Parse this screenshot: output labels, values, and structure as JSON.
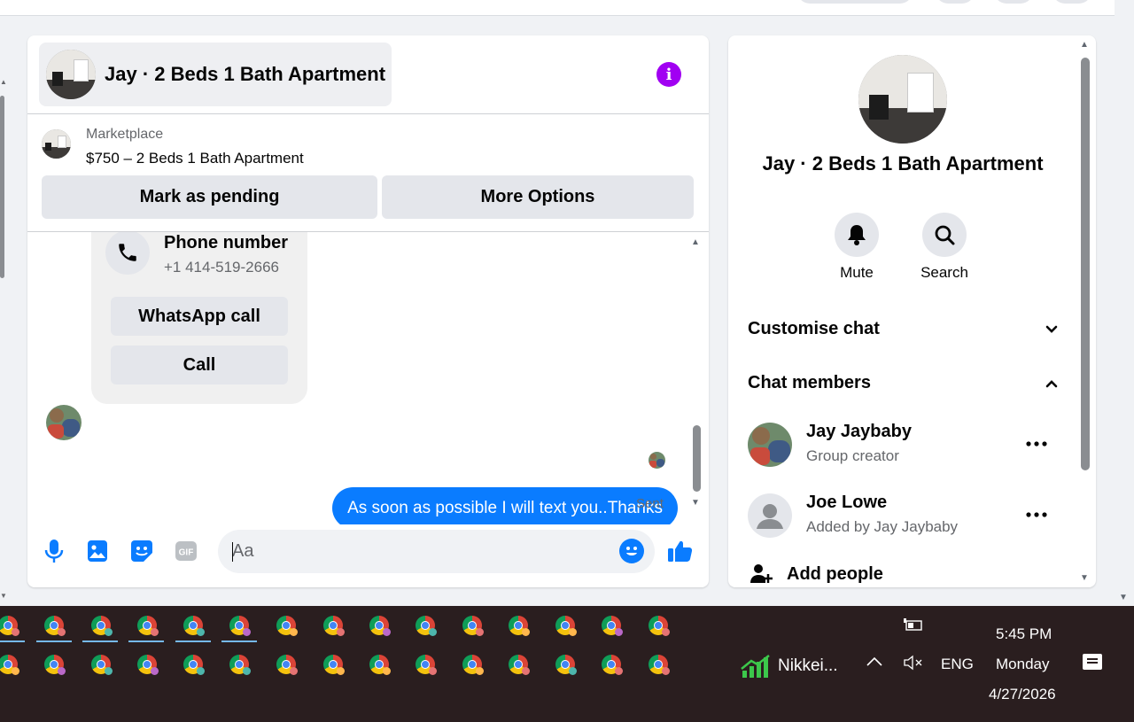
{
  "chat": {
    "title": "Jay · 2 Beds 1 Bath Apartment",
    "marketplace_label": "Marketplace",
    "listing": "$750 – 2 Beds 1 Bath Apartment",
    "mark_pending_label": "Mark as pending",
    "more_options_label": "More Options"
  },
  "contact_card": {
    "title": "Phone number",
    "number": "+1 414-519-2666",
    "whatsapp_label": "WhatsApp call",
    "call_label": "Call"
  },
  "messages": [
    {
      "direction": "outgoing",
      "text": "As soon as possible I will text you..Thanks",
      "status": "Sent"
    }
  ],
  "composer": {
    "placeholder": "Aa",
    "icons": [
      "microphone-icon",
      "image-icon",
      "sticker-icon",
      "gif-icon",
      "emoji-icon",
      "thumbs-up-icon"
    ],
    "gif_text": "GIF"
  },
  "info_panel": {
    "title": "Jay · 2 Beds 1 Bath Apartment",
    "actions": [
      {
        "label": "Mute",
        "icon": "bell-icon"
      },
      {
        "label": "Search",
        "icon": "search-icon"
      }
    ],
    "sections": {
      "customise": "Customise chat",
      "members": "Chat members"
    },
    "members": [
      {
        "name": "Jay Jaybaby",
        "role": "Group creator"
      },
      {
        "name": "Joe Lowe",
        "role": "Added by Jay Jaybaby"
      }
    ],
    "add_people_label": "Add people"
  },
  "taskbar": {
    "stock_label": "Nikkei...",
    "language": "ENG",
    "time": "5:45 PM",
    "day": "Monday",
    "date": "4/27/2026"
  },
  "colors": {
    "accent": "#0a7cff",
    "info_button": "#a100f2",
    "taskbar": "#2a1e1f"
  }
}
